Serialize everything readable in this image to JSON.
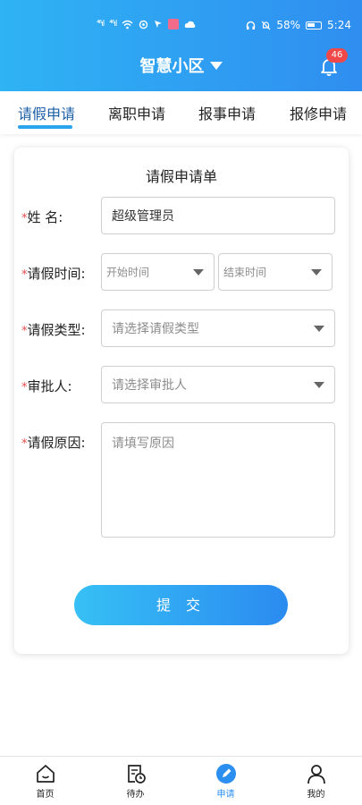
{
  "status_bar": {
    "signal1": "⁴⁶ıl",
    "signal2": "⁴⁶ıl",
    "battery_percent": "58%",
    "time": "5:24"
  },
  "header": {
    "title": "智慧小区",
    "notification_count": "46"
  },
  "tabs": [
    {
      "label": "请假申请",
      "active": true
    },
    {
      "label": "离职申请",
      "active": false
    },
    {
      "label": "报事申请",
      "active": false
    },
    {
      "label": "报修申请",
      "active": false
    }
  ],
  "form": {
    "title": "请假申请单",
    "required_mark": "*",
    "name_label": "姓 名:",
    "name_value": "超级管理员",
    "time_label": "请假时间:",
    "start_placeholder": "开始时间",
    "end_placeholder": "结束时间",
    "type_label": "请假类型:",
    "type_placeholder": "请选择请假类型",
    "approver_label": "审批人:",
    "approver_placeholder": "请选择审批人",
    "reason_label": "请假原因:",
    "reason_placeholder": "请填写原因",
    "submit_label": "提 交"
  },
  "bottom_nav": [
    {
      "label": "首页",
      "icon": "home-icon",
      "active": false
    },
    {
      "label": "待办",
      "icon": "todo-icon",
      "active": false
    },
    {
      "label": "申请",
      "icon": "apply-icon",
      "active": true
    },
    {
      "label": "我的",
      "icon": "profile-icon",
      "active": false
    }
  ],
  "colors": {
    "header_start": "#2fb3f4",
    "header_end": "#2f8ef0",
    "accent": "#2b8ff0",
    "required": "#e54b4b",
    "badge": "#f04848"
  }
}
